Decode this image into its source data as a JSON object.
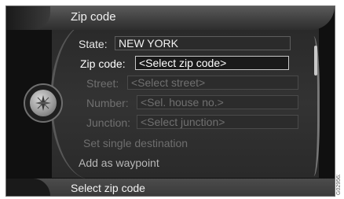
{
  "title": "Zip code",
  "fields": [
    {
      "label": "State:",
      "value": "NEW YORK",
      "state": "normal"
    },
    {
      "label": "Zip code:",
      "value": "<Select zip code>",
      "state": "active"
    },
    {
      "label": "Street:",
      "value": "<Select street>",
      "state": "disabled"
    },
    {
      "label": "Number:",
      "value": "<Sel. house no.>",
      "state": "disabled"
    },
    {
      "label": "Junction:",
      "value": "<Select junction>",
      "state": "disabled"
    }
  ],
  "actions": {
    "set_single_destination": "Set single destination",
    "add_as_waypoint": "Add as waypoint"
  },
  "status": "Select zip code",
  "image_code": "G029562",
  "colors": {
    "background": "#101010",
    "text": "#f2f2f2",
    "disabled_text": "#707070",
    "highlight_border": "#c8c8c8"
  },
  "icons": {
    "knob": "compass-knob-icon"
  }
}
